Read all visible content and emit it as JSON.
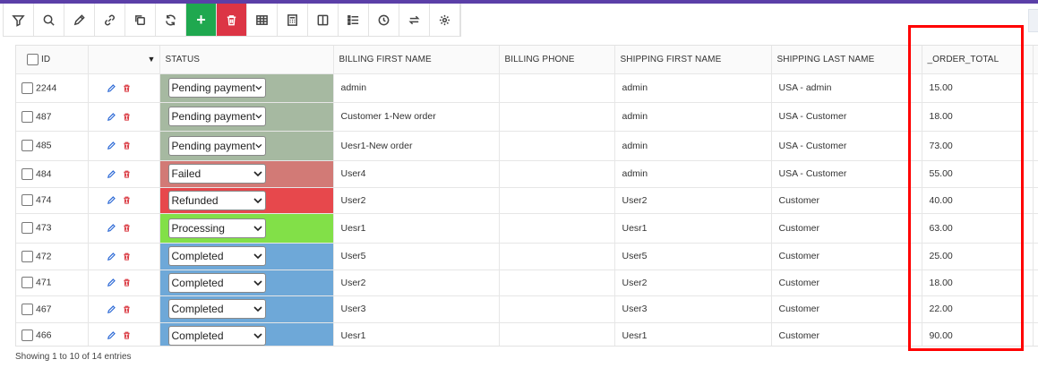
{
  "toolbar": {
    "buttons": [
      {
        "name": "filter-button",
        "icon": "filter-icon"
      },
      {
        "name": "search-button",
        "icon": "search-icon"
      },
      {
        "name": "edit-button",
        "icon": "edit-icon"
      },
      {
        "name": "link-button",
        "icon": "link-icon"
      },
      {
        "name": "duplicate-button",
        "icon": "copy-icon"
      },
      {
        "name": "refresh-button",
        "icon": "refresh-icon"
      },
      {
        "name": "add-button",
        "icon": "plus-icon",
        "label": "+"
      },
      {
        "name": "delete-button",
        "icon": "trash-icon"
      },
      {
        "name": "table-view-button",
        "icon": "table-icon"
      },
      {
        "name": "calculator-button",
        "icon": "calculator-icon"
      },
      {
        "name": "columns-button",
        "icon": "columns-icon"
      },
      {
        "name": "list-button",
        "icon": "list-icon"
      },
      {
        "name": "history-button",
        "icon": "clock-icon"
      },
      {
        "name": "sync-button",
        "icon": "swap-icon"
      },
      {
        "name": "settings-button",
        "icon": "gear-icon"
      }
    ]
  },
  "table": {
    "headers": {
      "id": "ID",
      "status": "STATUS",
      "billing_first_name": "BILLING FIRST NAME",
      "billing_phone": "BILLING PHONE",
      "shipping_first_name": "SHIPPING FIRST NAME",
      "shipping_last_name": "SHIPPING LAST NAME",
      "order_total": "_ORDER_TOTAL"
    },
    "status_colors": {
      "Pending payment": "#a6b9a1",
      "Failed": "#d27a76",
      "Refunded": "#e7484c",
      "Processing": "#82e048",
      "Completed": "#6ea8d8"
    },
    "rows": [
      {
        "id": "2244",
        "status": "Pending payment",
        "billing_first_name": "admin",
        "billing_phone": "",
        "shipping_first_name": "admin",
        "shipping_last_name": "USA - admin",
        "order_total": "15.00"
      },
      {
        "id": "487",
        "status": "Pending payment",
        "billing_first_name": "Customer 1-New order",
        "billing_phone": "",
        "shipping_first_name": "admin",
        "shipping_last_name": "USA - Customer",
        "order_total": "18.00"
      },
      {
        "id": "485",
        "status": "Pending payment",
        "billing_first_name": "Uesr1-New order",
        "billing_phone": "",
        "shipping_first_name": "admin",
        "shipping_last_name": "USA - Customer",
        "order_total": "73.00"
      },
      {
        "id": "484",
        "status": "Failed",
        "billing_first_name": "User4",
        "billing_phone": "",
        "shipping_first_name": "admin",
        "shipping_last_name": "USA - Customer",
        "order_total": "55.00"
      },
      {
        "id": "474",
        "status": "Refunded",
        "billing_first_name": "User2",
        "billing_phone": "",
        "shipping_first_name": "User2",
        "shipping_last_name": "Customer",
        "order_total": "40.00"
      },
      {
        "id": "473",
        "status": "Processing",
        "billing_first_name": "Uesr1",
        "billing_phone": "",
        "shipping_first_name": "Uesr1",
        "shipping_last_name": "Customer",
        "order_total": "63.00"
      },
      {
        "id": "472",
        "status": "Completed",
        "billing_first_name": "User5",
        "billing_phone": "",
        "shipping_first_name": "User5",
        "shipping_last_name": "Customer",
        "order_total": "25.00"
      },
      {
        "id": "471",
        "status": "Completed",
        "billing_first_name": "User2",
        "billing_phone": "",
        "shipping_first_name": "User2",
        "shipping_last_name": "Customer",
        "order_total": "18.00"
      },
      {
        "id": "467",
        "status": "Completed",
        "billing_first_name": "User3",
        "billing_phone": "",
        "shipping_first_name": "User3",
        "shipping_last_name": "Customer",
        "order_total": "22.00"
      },
      {
        "id": "466",
        "status": "Completed",
        "billing_first_name": "Uesr1",
        "billing_phone": "",
        "shipping_first_name": "Uesr1",
        "shipping_last_name": "Customer",
        "order_total": "90.00"
      }
    ]
  },
  "footer": {
    "entries_text": "Showing 1 to 10 of 14 entries"
  },
  "annotation": {
    "color": "#ff0000"
  }
}
